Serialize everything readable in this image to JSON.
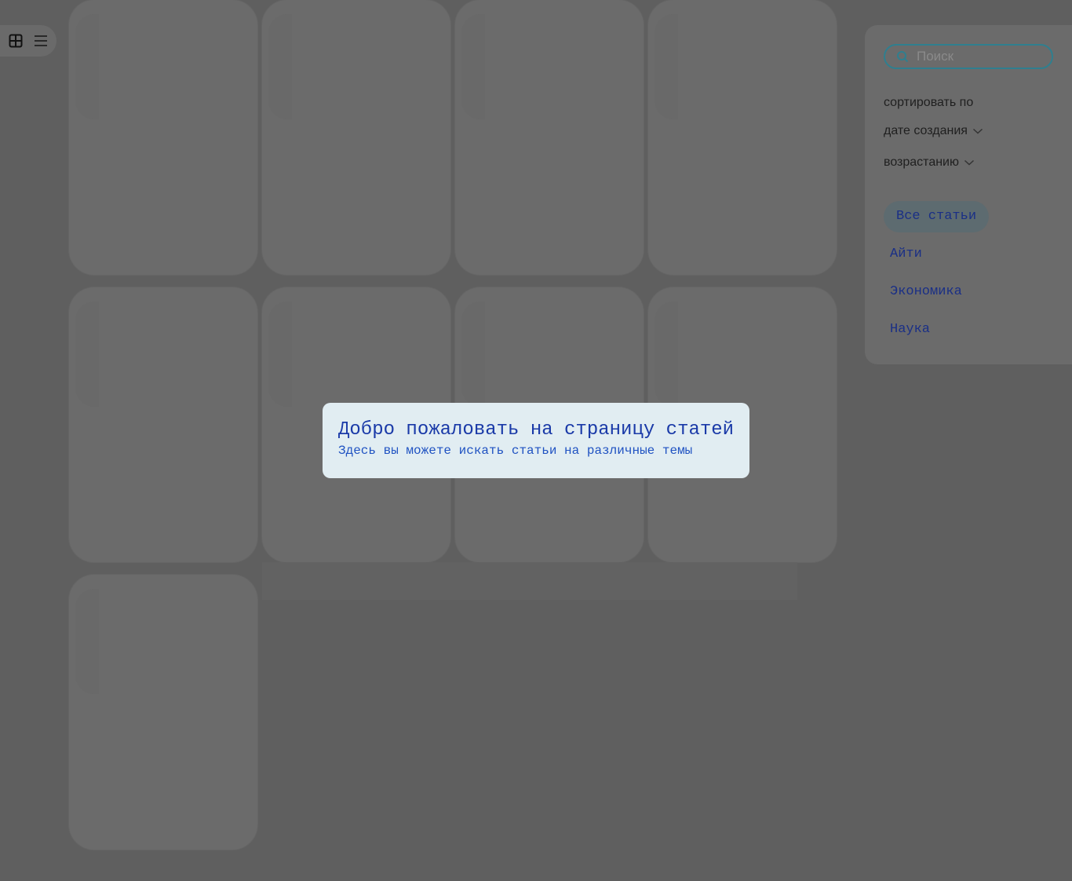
{
  "view_toggle": {
    "grid_icon": "grid-view-icon",
    "list_icon": "list-view-icon",
    "selected": "grid"
  },
  "sidebar": {
    "search": {
      "placeholder": "Поиск",
      "value": "",
      "icon": "search-icon"
    },
    "sort_label": "сортировать по",
    "sort_field": {
      "value": "дате создания",
      "icon": "chevron-down-icon"
    },
    "sort_order": {
      "value": "возрастанию",
      "icon": "chevron-down-icon"
    },
    "tags": [
      {
        "label": "Все статьи",
        "active": true
      },
      {
        "label": "Айти",
        "active": false
      },
      {
        "label": "Экономика",
        "active": false
      },
      {
        "label": "Наука",
        "active": false
      }
    ]
  },
  "welcome": {
    "title": "Добро пожаловать на страницу статей",
    "subtitle": "Здесь вы можете искать статьи на различные темы"
  },
  "colors": {
    "accent": "#1a3aa8",
    "search_border": "#2f7f8f",
    "notice_bg": "#e1edf2"
  }
}
